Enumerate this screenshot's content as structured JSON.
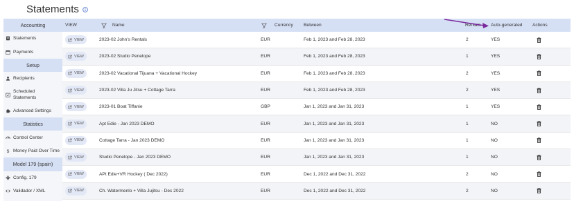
{
  "page": {
    "title": "Statements"
  },
  "sidebar": {
    "header": "Accounting",
    "items": [
      {
        "label": "Statements",
        "icon": "document-icon",
        "type": "item"
      },
      {
        "label": "Payments",
        "icon": "calendar-icon",
        "type": "item"
      },
      {
        "label": "Setup",
        "icon": "",
        "type": "section"
      },
      {
        "label": "Recipients",
        "icon": "person-icon",
        "type": "item"
      },
      {
        "label": "Scheduled Statements",
        "icon": "scheduled-icon",
        "type": "item"
      },
      {
        "label": "Advanced Settings",
        "icon": "puzzle-icon",
        "type": "item"
      },
      {
        "label": "Statistics",
        "icon": "",
        "type": "section"
      },
      {
        "label": "Control Center",
        "icon": "gauge-icon",
        "type": "item"
      },
      {
        "label": "Money Paid Over Time",
        "icon": "dollar-icon",
        "type": "item"
      },
      {
        "label": "Model 179 (spain)",
        "icon": "",
        "type": "section"
      },
      {
        "label": "Config. 179",
        "icon": "gear-icon",
        "type": "item"
      },
      {
        "label": "Validador / XML",
        "icon": "code-icon",
        "type": "item"
      }
    ]
  },
  "table": {
    "headers": {
      "view": "VIEW",
      "name": "Name",
      "currency": "Currency",
      "between": "Between",
      "rentals": "Rentals",
      "auto": "Auto-generated",
      "actions": "Actions"
    },
    "view_label": "VIEW",
    "rows": [
      {
        "name": "2023-02 John's Rentals",
        "currency": "EUR",
        "between": "Feb 1, 2023 and Feb 28, 2023",
        "rentals": "2",
        "auto": "YES"
      },
      {
        "name": "2023-02 Studio Penelope",
        "currency": "EUR",
        "between": "Feb 1, 2023 and Feb 28, 2023",
        "rentals": "1",
        "auto": "YES"
      },
      {
        "name": "2023-02 Vacational Tijuana + Vacational Hockey",
        "currency": "EUR",
        "between": "Feb 1, 2023 and Feb 28, 2023",
        "rentals": "2",
        "auto": "YES"
      },
      {
        "name": "2023-02 Villa Ju Jitsu + Cottage Tarra",
        "currency": "EUR",
        "between": "Feb 1, 2023 and Feb 28, 2023",
        "rentals": "2",
        "auto": "YES"
      },
      {
        "name": "2023-01 Boat Tiffanie",
        "currency": "GBP",
        "between": "Jan 1, 2023 and Jan 31, 2023",
        "rentals": "1",
        "auto": "YES"
      },
      {
        "name": "Apt Edie - Jan 2023 DEMO",
        "currency": "EUR",
        "between": "Jan 1, 2023 and Jan 31, 2023",
        "rentals": "1",
        "auto": "NO"
      },
      {
        "name": "Cottage Tarra - Jan 2023 DEMO",
        "currency": "EUR",
        "between": "Jan 1, 2023 and Jan 31, 2023",
        "rentals": "1",
        "auto": "NO"
      },
      {
        "name": "Studio Penelope - Jan 2023 DEMO",
        "currency": "EUR",
        "between": "Jan 1, 2023 and Jan 31, 2023",
        "rentals": "1",
        "auto": "NO"
      },
      {
        "name": "APt Edie+VR Hockey ( Dec 2022)",
        "currency": "EUR",
        "between": "Dec 1, 2022 and Dec 31, 2022",
        "rentals": "2",
        "auto": "NO"
      },
      {
        "name": "Ch. Watermenlo + Villa Jujitsu - Dec 2022",
        "currency": "EUR",
        "between": "Dec 1, 2022 and Dec 31, 2022",
        "rentals": "2",
        "auto": "NO"
      }
    ]
  },
  "colors": {
    "accent": "#d6e0f5",
    "arrow": "#7b2a9e",
    "row_alt": "#f2f4f7",
    "view_button": "#e3e8f7"
  }
}
